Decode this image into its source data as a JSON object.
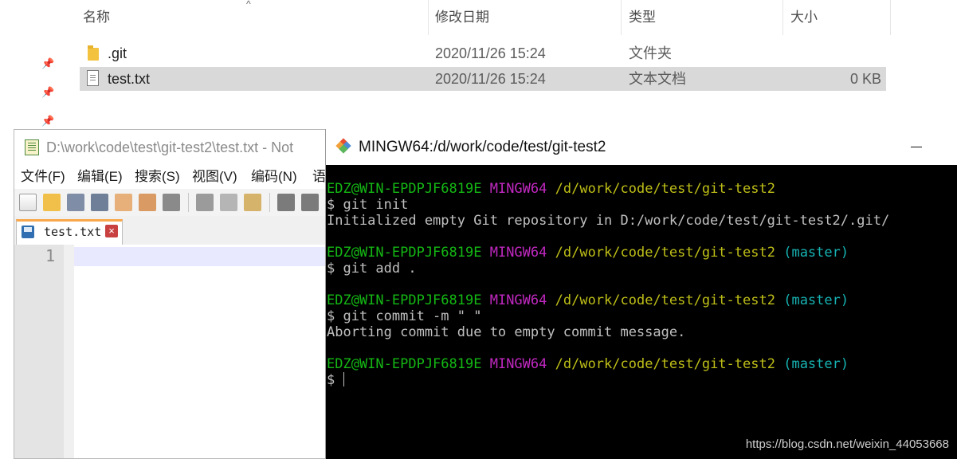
{
  "explorer": {
    "columns": {
      "name": "名称",
      "modified": "修改日期",
      "type": "类型",
      "size": "大小"
    },
    "files": [
      {
        "name": ".git",
        "modified": "2020/11/26 15:24",
        "type": "文件夹",
        "size": "",
        "icon": "folder-icon"
      },
      {
        "name": "test.txt",
        "modified": "2020/11/26 15:24",
        "type": "文本文档",
        "size": "0 KB",
        "icon": "text-file-icon",
        "selected": true
      }
    ]
  },
  "notepad": {
    "title": "D:\\work\\code\\test\\git-test2\\test.txt - Not",
    "menus": [
      "文件(F)",
      "编辑(E)",
      "搜索(S)",
      "视图(V)",
      "编码(N)",
      "语"
    ],
    "tab_label": "test.txt",
    "line_number": "1"
  },
  "terminal": {
    "title": "MINGW64:/d/work/code/test/git-test2",
    "prompt": {
      "user": "EDZ@WIN-EPDPJF6819E",
      "env": "MINGW64",
      "path": "/d/work/code/test/git-test2",
      "branch": "(master)"
    },
    "cmd1": "$ git init",
    "out1": "Initialized empty Git repository in D:/work/code/test/git-test2/.git/",
    "cmd2": "$ git add .",
    "cmd3": "$ git commit -m \" \"",
    "out3": "Aborting commit due to empty commit message.",
    "cmd4": "$ ",
    "colors": {
      "user": "#14b814",
      "env": "#c028c0",
      "path": "#bfbf18",
      "branch": "#17b3b3"
    }
  },
  "watermark": "https://blog.csdn.net/weixin_44053668"
}
